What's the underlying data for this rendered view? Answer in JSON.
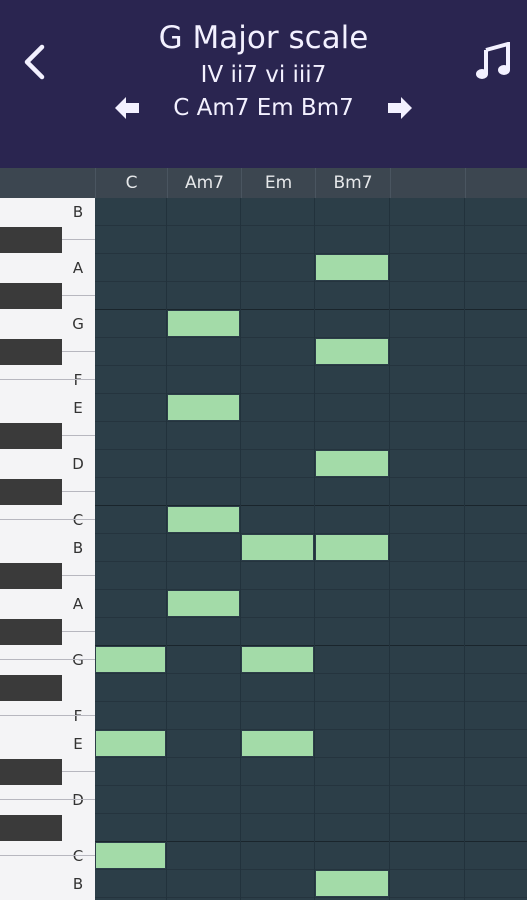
{
  "header": {
    "title": "G Major scale",
    "numerals": "IV ii7 vi iii7",
    "chords": "C Am7 Em Bm7",
    "icons": [
      "chevron-left-icon",
      "music-note-icon",
      "arrow-left-icon",
      "arrow-right-icon"
    ]
  },
  "columns": [
    "C",
    "Am7",
    "Em",
    "Bm7",
    "",
    ""
  ],
  "key_labels": [
    "B",
    "A",
    "G",
    "F",
    "E",
    "D",
    "C",
    "B",
    "A",
    "G",
    "F",
    "E",
    "D",
    "C",
    "B"
  ],
  "colors": {
    "header_bg": "#2a2550",
    "grid_bg": "#2c3e48",
    "note": "#a3dba8",
    "text": "#f3f1ff"
  },
  "notes": [
    {
      "col": 3,
      "row": 2
    },
    {
      "col": 1,
      "row": 4
    },
    {
      "col": 3,
      "row": 5
    },
    {
      "col": 1,
      "row": 7
    },
    {
      "col": 3,
      "row": 9
    },
    {
      "col": 1,
      "row": 11
    },
    {
      "col": 2,
      "row": 12
    },
    {
      "col": 3,
      "row": 12
    },
    {
      "col": 1,
      "row": 14
    },
    {
      "col": 0,
      "row": 16
    },
    {
      "col": 2,
      "row": 16
    },
    {
      "col": 0,
      "row": 19
    },
    {
      "col": 2,
      "row": 19
    },
    {
      "col": 0,
      "row": 23
    },
    {
      "col": 3,
      "row": 24
    }
  ]
}
